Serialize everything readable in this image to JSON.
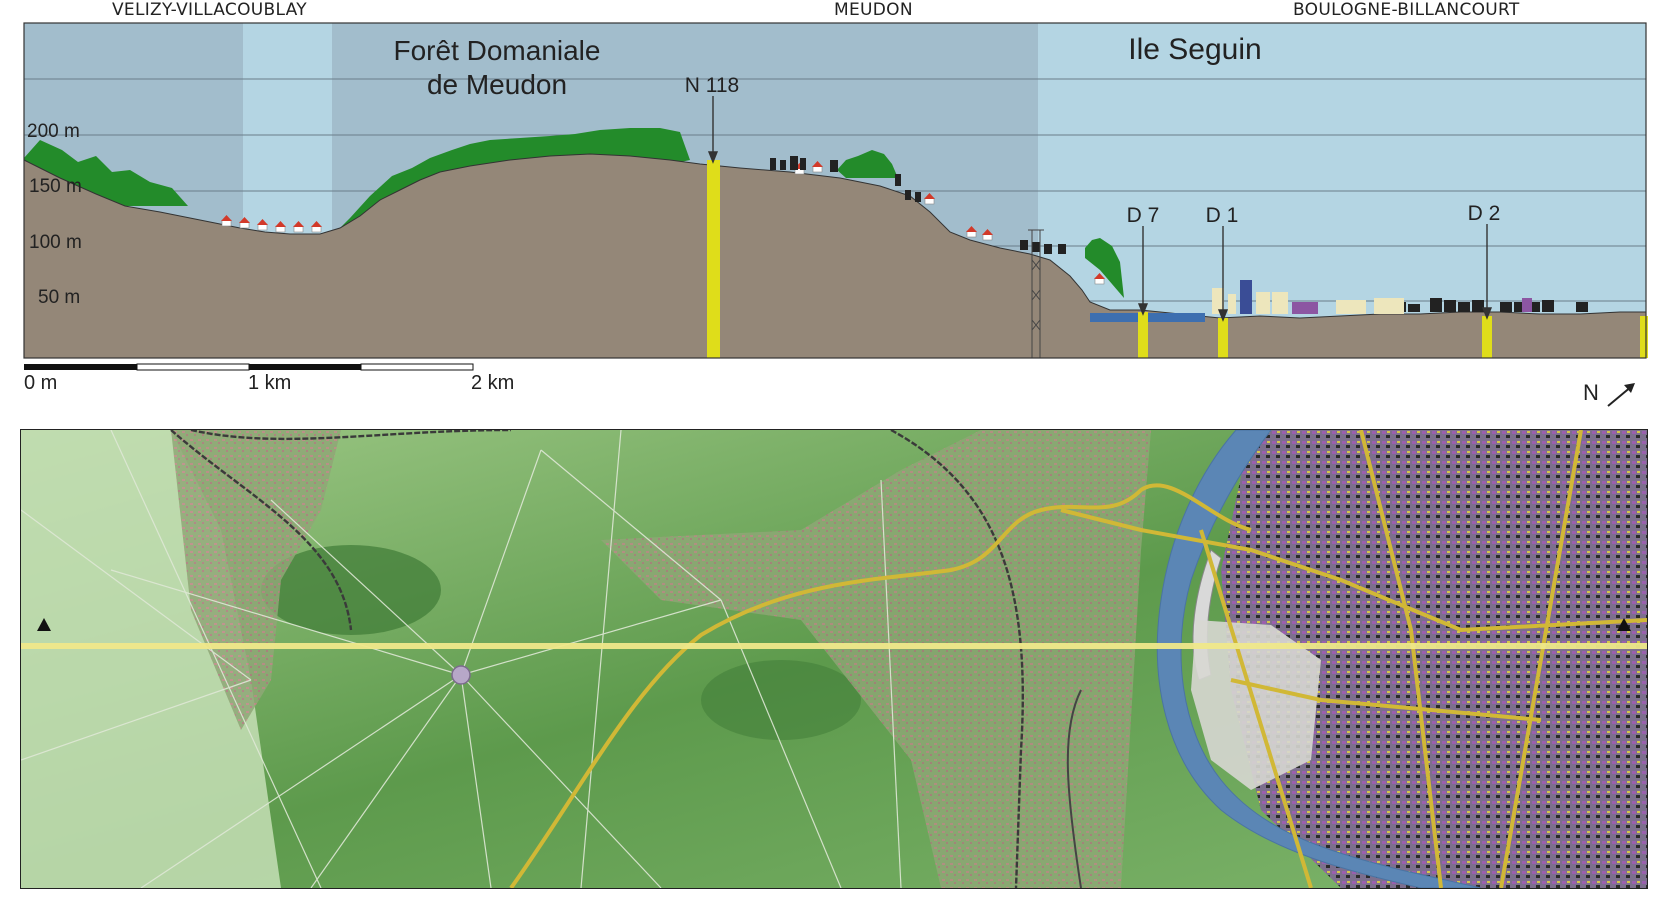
{
  "colors": {
    "sky_light": "#b4d5e3",
    "sky_dark": "#a2bdcc",
    "terrain": "#948778",
    "forest": "#238b2a",
    "road_marker": "#dfdd1a",
    "water": "#3d6fb0",
    "map_forest": "#6ca45b",
    "map_urban": "#8a7f9e",
    "transect": "#efe88a"
  },
  "communes": [
    {
      "name": "VELIZY-VILLACOUBLAY"
    },
    {
      "name": "MEUDON"
    },
    {
      "name": "BOULOGNE-BILLANCOURT"
    }
  ],
  "areas": [
    {
      "line1": "Forêt Domaniale",
      "line2": "de Meudon"
    },
    {
      "line1": "Ile Seguin",
      "line2": ""
    }
  ],
  "altitudes": [
    "200 m",
    "150 m",
    "100 m",
    "50 m"
  ],
  "roads": [
    {
      "label": "N 118"
    },
    {
      "label": "D 7"
    },
    {
      "label": "D 1"
    },
    {
      "label": "D 2"
    }
  ],
  "scale": {
    "labels": [
      "0 m",
      "1 km",
      "2 km"
    ]
  },
  "north": {
    "label": "N",
    "icon": "north-arrow-icon"
  },
  "map": {
    "transect_markers": [
      "triangle-marker-west-icon",
      "triangle-marker-east-icon"
    ]
  }
}
